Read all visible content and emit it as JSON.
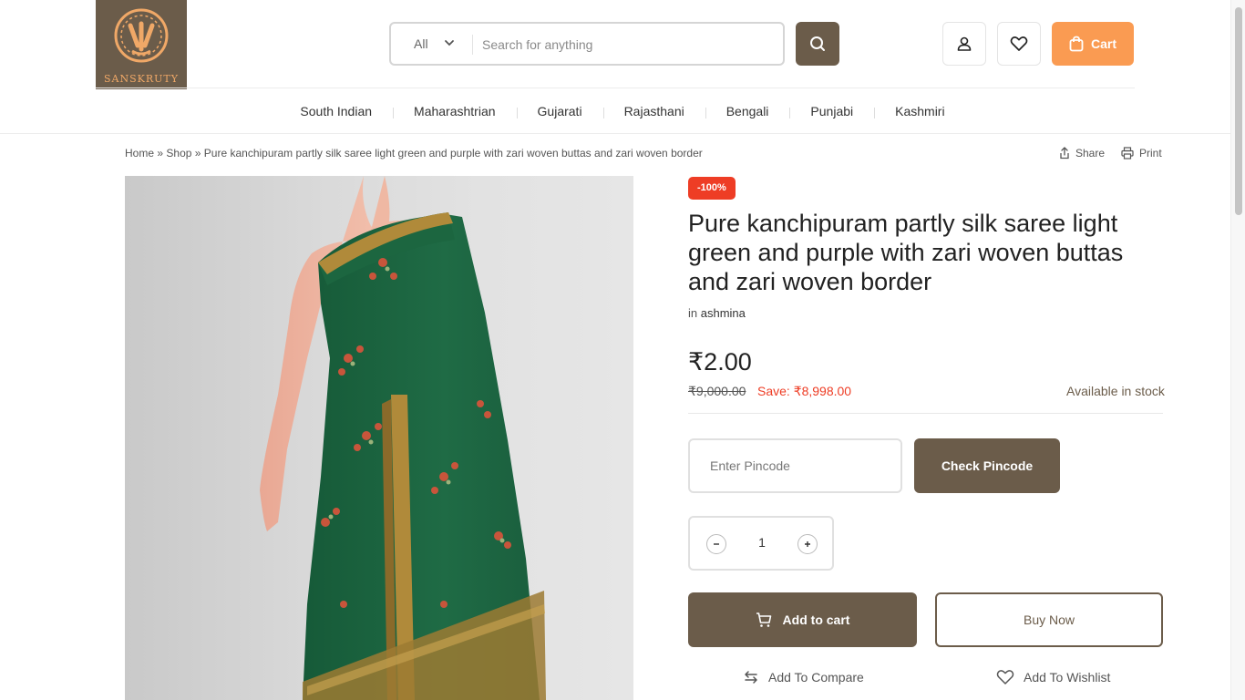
{
  "brand": {
    "name": "SANSKRUTY",
    "logo_bg": "#6b5c4a",
    "logo_fg": "#f0a867"
  },
  "search": {
    "category": "All",
    "placeholder": "Search for anything",
    "value": ""
  },
  "header": {
    "account_icon": "user-icon",
    "wishlist_icon": "heart-icon",
    "cart_label": "Cart",
    "cart_color": "#fa9b52"
  },
  "nav": {
    "items": [
      "South Indian",
      "Maharashtrian",
      "Gujarati",
      "Rajasthani",
      "Bengali",
      "Punjabi",
      "Kashmiri"
    ]
  },
  "breadcrumb": {
    "home": "Home",
    "shop": "Shop",
    "separator": "»",
    "current": "Pure kanchipuram partly silk saree light green and purple with zari woven buttas and zari woven border"
  },
  "actions": {
    "share": "Share",
    "print": "Print"
  },
  "product": {
    "badge": "-100%",
    "title": "Pure kanchipuram partly silk saree light green and purple with zari woven buttas and zari woven border",
    "category_prefix": "in",
    "category": "ashmina",
    "price": "₹2.00",
    "old_price": "₹9,000.00",
    "save": "Save: ₹8,998.00",
    "stock": "Available in stock",
    "quantity": "1"
  },
  "pincode": {
    "placeholder": "Enter Pincode",
    "value": "",
    "button": "Check Pincode"
  },
  "buttons": {
    "add_to_cart": "Add to cart",
    "buy_now": "Buy Now",
    "compare": "Add To Compare",
    "wishlist": "Add To Wishlist"
  },
  "colors": {
    "primary": "#6b5c4a",
    "accent": "#fa9b52",
    "sale": "#ee3d25",
    "saree": "#1f6b45",
    "zari": "#b08a3a"
  }
}
